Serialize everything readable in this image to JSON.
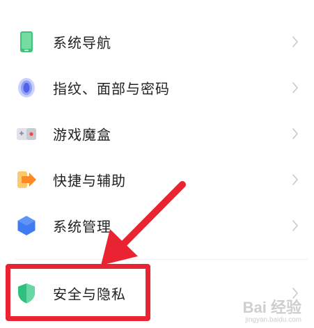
{
  "settings": {
    "items": [
      {
        "label": "系统导航",
        "icon": "navigation-phone-icon"
      },
      {
        "label": "指纹、面部与密码",
        "icon": "fingerprint-icon"
      },
      {
        "label": "游戏魔盒",
        "icon": "game-box-icon"
      },
      {
        "label": "快捷与辅助",
        "icon": "shortcut-arrow-icon"
      },
      {
        "label": "系统管理",
        "icon": "system-hexagon-icon"
      },
      {
        "label": "安全与隐私",
        "icon": "shield-icon"
      }
    ]
  },
  "watermark": {
    "main": "Bai 经验",
    "sub": "jingyan.baidu.com"
  },
  "colors": {
    "highlight": "#ea2332",
    "chevron": "#c8c8c8",
    "text": "#222222"
  }
}
